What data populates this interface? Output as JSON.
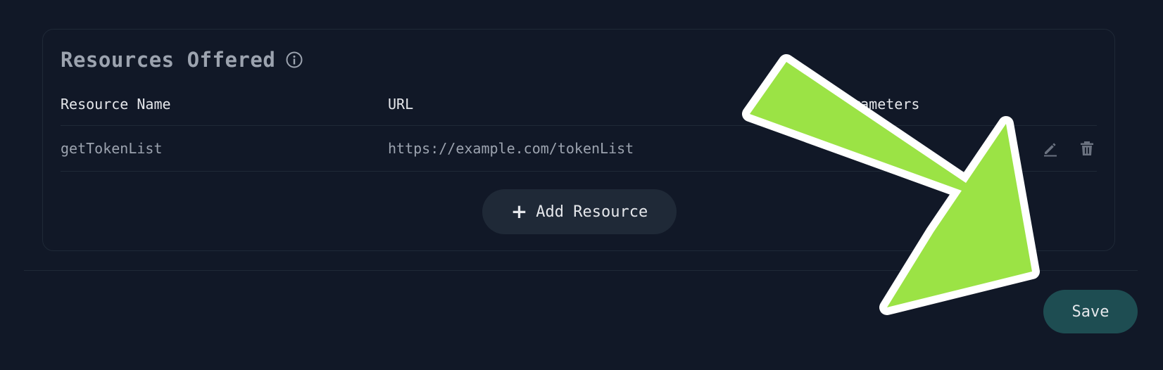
{
  "section": {
    "title": "Resources Offered",
    "info_icon": "info-icon"
  },
  "table": {
    "headers": [
      "Resource Name",
      "URL",
      "Parameters"
    ],
    "rows": [
      {
        "name": "getTokenList",
        "url": "https://example.com/tokenList",
        "parameters": ""
      }
    ],
    "row_action_icons": [
      "edit-icon",
      "trash-icon"
    ]
  },
  "add_button": {
    "label": "Add Resource",
    "icon": "plus-icon"
  },
  "footer": {
    "save_label": "Save"
  },
  "colors": {
    "background": "#111827",
    "card_border": "#1f2937",
    "button_bg": "#1f2937",
    "save_bg": "#1e4d52",
    "arrow_fill": "#9be345",
    "arrow_outline": "#ffffff"
  }
}
